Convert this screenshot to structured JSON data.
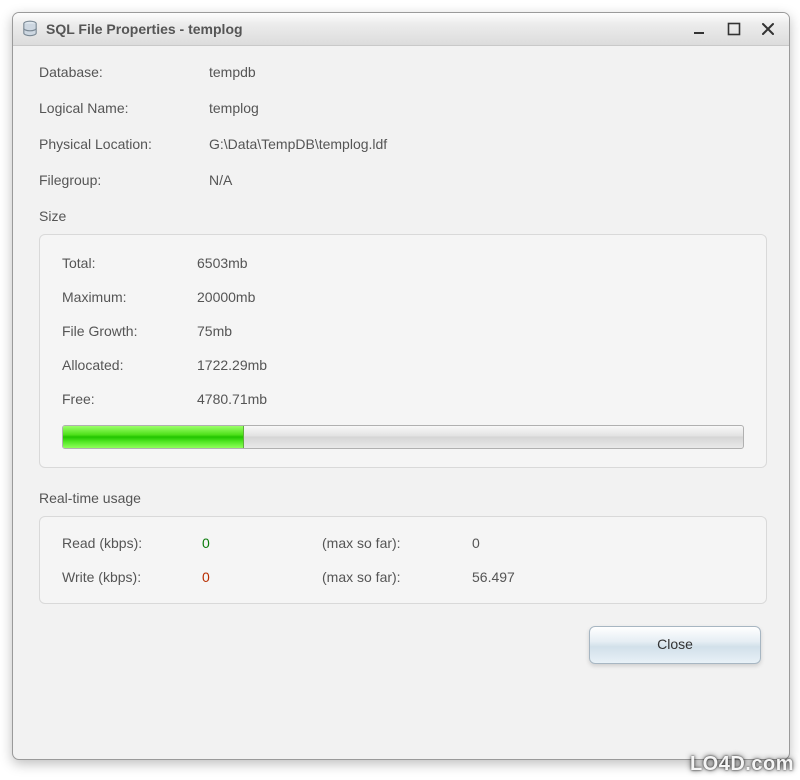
{
  "titlebar": {
    "text": "SQL File Properties - templog"
  },
  "header": {
    "database_label": "Database:",
    "database_value": "tempdb",
    "logical_name_label": "Logical Name:",
    "logical_name_value": "templog",
    "physical_location_label": "Physical Location:",
    "physical_location_value": "G:\\Data\\TempDB\\templog.ldf",
    "filegroup_label": "Filegroup:",
    "filegroup_value": "N/A"
  },
  "size": {
    "section_label": "Size",
    "total_label": "Total:",
    "total_value": "6503mb",
    "maximum_label": "Maximum:",
    "maximum_value": "20000mb",
    "file_growth_label": "File Growth:",
    "file_growth_value": "75mb",
    "allocated_label": "Allocated:",
    "allocated_value": "1722.29mb",
    "free_label": "Free:",
    "free_value": "4780.71mb",
    "allocated_pct": 26.5
  },
  "realtime": {
    "section_label": "Real-time usage",
    "read_label": "Read (kbps):",
    "read_value": "0",
    "read_max_label": "(max so far):",
    "read_max_value": "0",
    "write_label": "Write (kbps):",
    "write_value": "0",
    "write_max_label": "(max so far):",
    "write_max_value": "56.497"
  },
  "buttons": {
    "close_label": "Close"
  },
  "watermark": "LO4D.com"
}
